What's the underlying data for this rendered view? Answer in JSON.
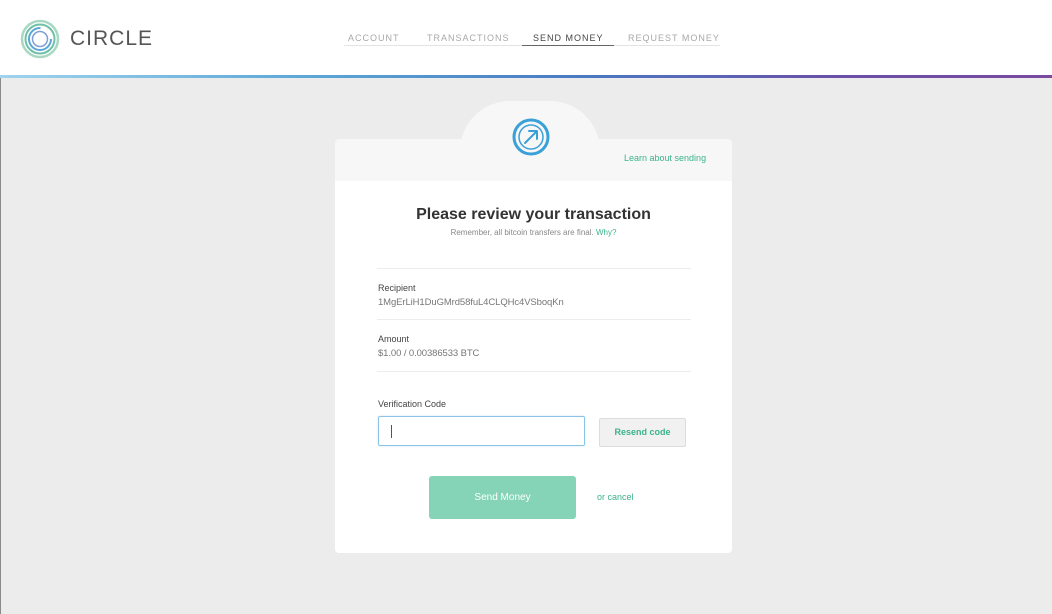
{
  "app": {
    "brand": "CIRCLE",
    "colors": {
      "accent": "#3cb38b",
      "button": "#85d4b8",
      "icon": "#3aa0d8"
    }
  },
  "nav": {
    "items": [
      {
        "label": "ACCOUNT",
        "active": false
      },
      {
        "label": "TRANSACTIONS",
        "active": false
      },
      {
        "label": "SEND MONEY",
        "active": true
      },
      {
        "label": "REQUEST MONEY",
        "active": false
      }
    ]
  },
  "card": {
    "icon": "send-arrow-icon",
    "learn_link": "Learn about sending",
    "title": "Please review your transaction",
    "subtitle": "Remember, all bitcoin transfers are final.",
    "why_link": "Why?",
    "recipient_label": "Recipient",
    "recipient_value": "1MgErLiH1DuGMrd58fuL4CLQHc4VSboqKn",
    "amount_label": "Amount",
    "amount_value": "$1.00 / 0.00386533 BTC",
    "code_label": "Verification Code",
    "code_value": "",
    "resend_label": "Resend code",
    "send_label": "Send Money",
    "cancel_label": "or cancel"
  }
}
